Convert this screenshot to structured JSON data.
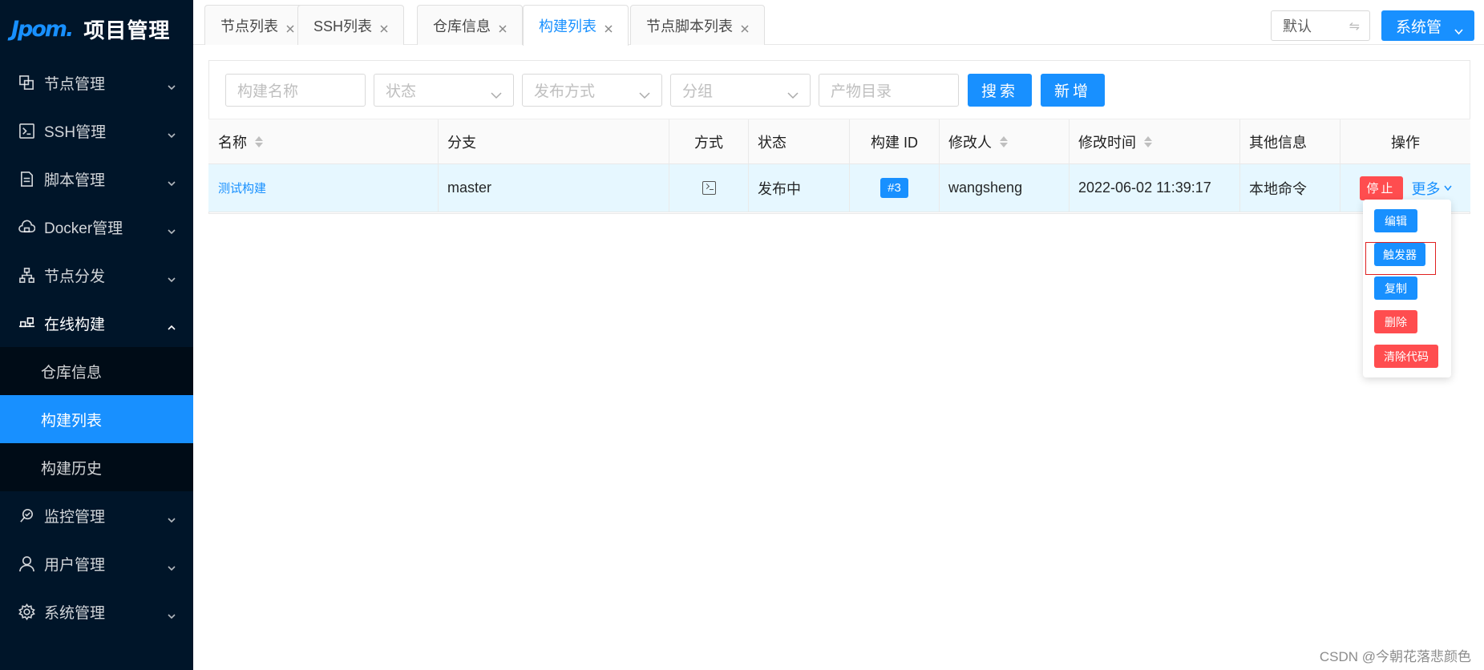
{
  "logo": {
    "mark": "Jpom.",
    "title": "项目管理"
  },
  "sidebar": {
    "items": [
      {
        "label": "节点管理",
        "icon": "cluster-icon"
      },
      {
        "label": "SSH管理",
        "icon": "terminal-icon"
      },
      {
        "label": "脚本管理",
        "icon": "file-icon"
      },
      {
        "label": "Docker管理",
        "icon": "cloud-icon"
      },
      {
        "label": "节点分发",
        "icon": "apartment-icon"
      },
      {
        "label": "在线构建",
        "icon": "build-icon"
      }
    ],
    "submenu": [
      {
        "label": "仓库信息"
      },
      {
        "label": "构建列表"
      },
      {
        "label": "构建历史"
      }
    ],
    "bottom_items": [
      {
        "label": "监控管理",
        "icon": "monitor-icon"
      },
      {
        "label": "用户管理",
        "icon": "user-icon"
      },
      {
        "label": "系统管理",
        "icon": "gear-icon"
      }
    ]
  },
  "tabs": [
    {
      "label": "节点列表"
    },
    {
      "label": "SSH列表"
    },
    {
      "label": "仓库信息"
    },
    {
      "label": "构建列表"
    },
    {
      "label": "节点脚本列表"
    }
  ],
  "header": {
    "workspace": "默认",
    "user_menu": "系统管"
  },
  "filters": {
    "name_placeholder": "构建名称",
    "status_placeholder": "状态",
    "release_placeholder": "发布方式",
    "group_placeholder": "分组",
    "artifact_placeholder": "产物目录",
    "search_label": "搜索",
    "add_label": "新增"
  },
  "table": {
    "columns": [
      "名称",
      "分支",
      "方式",
      "状态",
      "构建 ID",
      "修改人",
      "修改时间",
      "其他信息",
      "操作"
    ],
    "rows": [
      {
        "name": "测试构建",
        "branch": "master",
        "status": "发布中",
        "build_id": "#3",
        "modifier": "wangsheng",
        "modified_time": "2022-06-02 11:39:17",
        "other": "本地命令",
        "stop_label": "停止",
        "more_label": "更多"
      }
    ]
  },
  "dropdown": {
    "edit": "编辑",
    "trigger": "触发器",
    "copy": "复制",
    "delete": "删除",
    "clear_code": "清除代码"
  },
  "watermark": "CSDN @今朝花落悲颜色",
  "colors": {
    "primary": "#1890ff",
    "danger": "#ff4d4f",
    "sidebar": "#001529",
    "highlight": "#e02020"
  }
}
